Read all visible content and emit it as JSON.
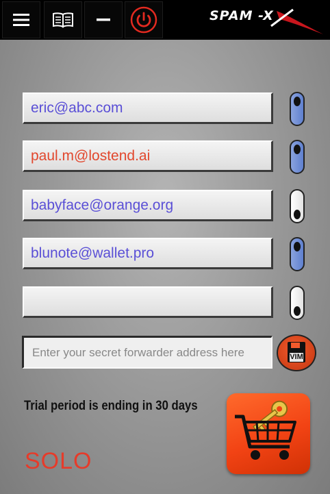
{
  "app": {
    "brand": "SPAM -X"
  },
  "toolbar": {
    "icons": [
      "menu-icon",
      "book-icon",
      "minus-icon",
      "power-icon"
    ],
    "power_color": "#e32a20"
  },
  "emails": [
    {
      "address": "eric@abc.com",
      "color": "#5a4fd6",
      "enabled": true
    },
    {
      "address": "paul.m@lostend.ai",
      "color": "#e2472d",
      "enabled": true
    },
    {
      "address": "babyface@orange.org",
      "color": "#5a4fd6",
      "enabled": false
    },
    {
      "address": "blunote@wallet.pro",
      "color": "#5a4fd6",
      "enabled": true
    },
    {
      "address": "",
      "color": "#5a4fd6",
      "enabled": false
    }
  ],
  "forwarder": {
    "placeholder": "Enter your secret forwarder address here",
    "value": ""
  },
  "save_button": {
    "label": "VIM",
    "icon": "floppy-disk-icon"
  },
  "trial": {
    "text": "Trial period is ending in 30 days"
  },
  "plan": {
    "label": "SOLO"
  },
  "store_button": {
    "icon": "shopping-cart-key-icon"
  },
  "colors": {
    "accent_orange": "#f24314",
    "toggle_on": "#6f8dd6",
    "plan_red": "#e63b2a"
  }
}
